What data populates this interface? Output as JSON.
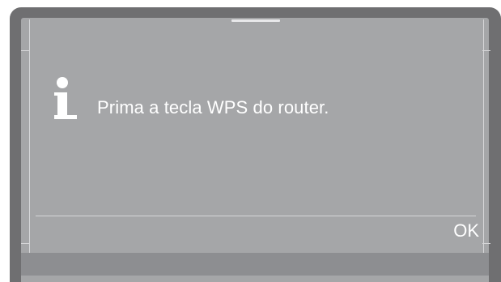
{
  "dialog": {
    "icon": "info-icon",
    "message": "Prima a tecla WPS do router.",
    "ok_label": "OK"
  },
  "colors": {
    "bezel": "#6f6f71",
    "screen": "#a5a6a8",
    "text": "#ffffff",
    "lines": "#d6d6d8"
  }
}
